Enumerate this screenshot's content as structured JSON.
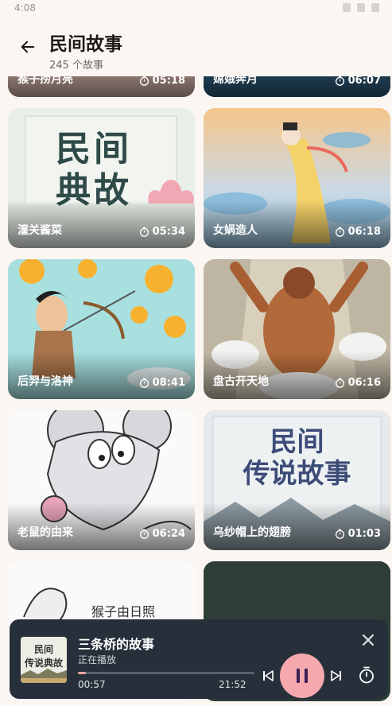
{
  "status": {
    "time": "4:08"
  },
  "header": {
    "title": "民间故事",
    "subtitle": "245 个故事"
  },
  "stories": [
    {
      "title": "猴子捞月亮",
      "duration": "05:18",
      "cover": "partial"
    },
    {
      "title": "嫦娥奔月",
      "duration": "06:07",
      "cover": "partial"
    },
    {
      "title": "潼关酱菜",
      "duration": "05:34",
      "cover": "民间典故"
    },
    {
      "title": "女娲造人",
      "duration": "06:18",
      "cover": "goddess"
    },
    {
      "title": "后羿与洛神",
      "duration": "08:41",
      "cover": "archer"
    },
    {
      "title": "盘古开天地",
      "duration": "06:16",
      "cover": "giant"
    },
    {
      "title": "老鼠的由来",
      "duration": "06:24",
      "cover": "mouse"
    },
    {
      "title": "乌纱帽上的翅膀",
      "duration": "01:03",
      "cover": "民间传说故事"
    }
  ],
  "cover_texts": {
    "folk_idiom_line1": "民间",
    "folk_idiom_line2": "典故",
    "folk_legend_line1": "民间",
    "folk_legend_line2": "传说故事",
    "peek_text": "猴子由日照"
  },
  "player": {
    "title": "三条桥的故事",
    "status": "正在播放",
    "current_time": "00:57",
    "total_time": "21:52",
    "progress": 0.043,
    "cover_line1": "民间",
    "cover_line2": "传说典故"
  },
  "colors": {
    "background": "#FBF6F2",
    "player_bg": "#27303A",
    "accent": "#F5A9AE",
    "text_primary": "#1D1B1A"
  },
  "icons": [
    "back-arrow-icon",
    "timer-icon",
    "previous-icon",
    "pause-icon",
    "next-icon",
    "sleep-timer-icon",
    "close-icon"
  ]
}
